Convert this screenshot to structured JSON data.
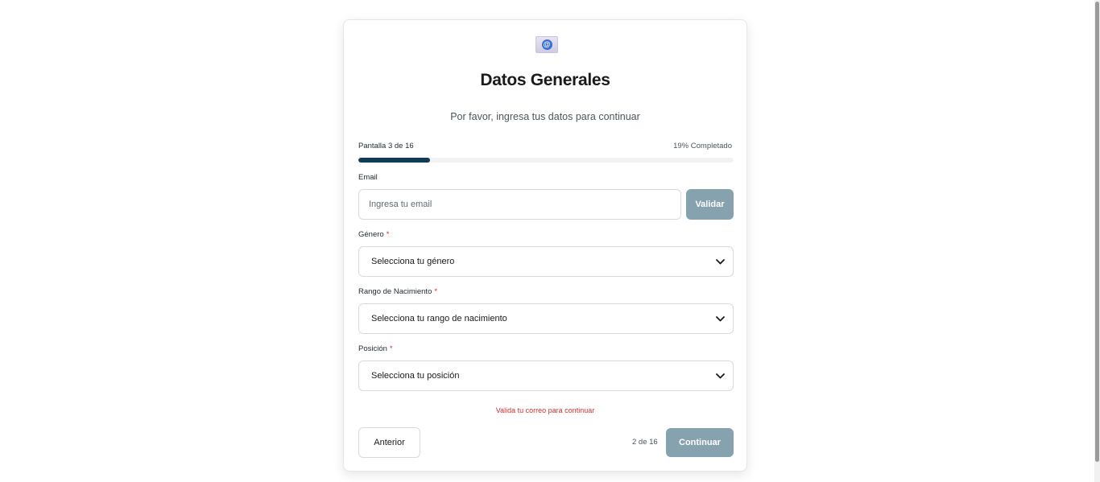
{
  "header": {
    "logo_icon": "email-at-icon",
    "title": "Datos Generales",
    "subtitle": "Por favor, ingresa tus datos para continuar"
  },
  "progress": {
    "screen_label": "Pantalla 3 de 16",
    "percent_label": "19% Completado",
    "percent_value": 19,
    "fill_color": "#103a55"
  },
  "form": {
    "email": {
      "label": "Email",
      "value": "",
      "placeholder": "Ingresa tu email",
      "validate_label": "Validar"
    },
    "gender": {
      "label": "Género",
      "required_mark": "*",
      "selected": "Selecciona tu género"
    },
    "birth_range": {
      "label": "Rango de Nacimiento",
      "required_mark": "*",
      "selected": "Selecciona tu rango de nacimiento"
    },
    "position": {
      "label": "Posición",
      "required_mark": "*",
      "selected": "Selecciona tu posición"
    },
    "error_message": "Valida tu correo para continuar"
  },
  "footer": {
    "prev_label": "Anterior",
    "step_count": "2 de 16",
    "next_label": "Continuar"
  },
  "colors": {
    "primary_disabled": "#87a2af",
    "error": "#d32f2f",
    "progress": "#103a55"
  }
}
